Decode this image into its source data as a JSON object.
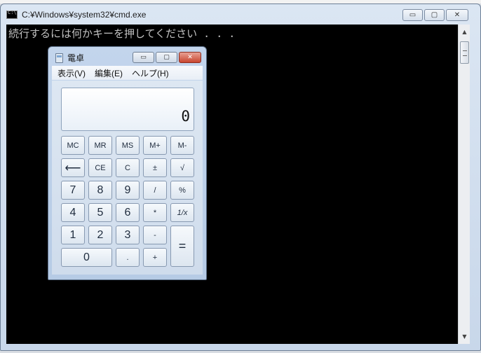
{
  "cmd": {
    "title": "C:¥Windows¥system32¥cmd.exe",
    "console_line": "続行するには何かキーを押してください . . .",
    "minimize_glyph": "▭",
    "maximize_glyph": "▢",
    "close_glyph": "✕",
    "scroll_up_glyph": "▲",
    "scroll_down_glyph": "▼"
  },
  "calculator": {
    "title": "電卓",
    "minimize_glyph": "▭",
    "maximize_glyph": "▢",
    "close_glyph": "✕",
    "menu": [
      "表示(V)",
      "編集(E)",
      "ヘルプ(H)"
    ],
    "display_value": "0",
    "keys": {
      "mc": "MC",
      "mr": "MR",
      "ms": "MS",
      "mplus": "M+",
      "mminus": "M-",
      "backspace": "⟵",
      "ce": "CE",
      "c": "C",
      "plusminus": "±",
      "sqrt": "√",
      "n7": "7",
      "n8": "8",
      "n9": "9",
      "divide": "/",
      "percent": "%",
      "n4": "4",
      "n5": "5",
      "n6": "6",
      "multiply": "*",
      "reciprocal": "1/x",
      "n1": "1",
      "n2": "2",
      "n3": "3",
      "minus": "-",
      "equals": "=",
      "n0": "0",
      "decimal": ".",
      "plus": "+"
    }
  }
}
